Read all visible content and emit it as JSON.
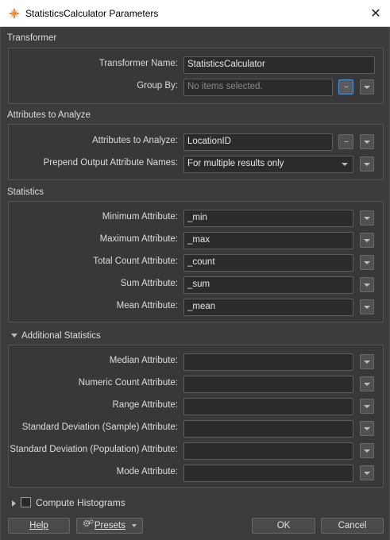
{
  "window": {
    "title": "StatisticsCalculator Parameters",
    "close_glyph": "✕"
  },
  "sections": {
    "transformer": "Transformer",
    "attributes": "Attributes to Analyze",
    "statistics": "Statistics",
    "additional": "Additional Statistics",
    "histograms": "Compute Histograms"
  },
  "transformer": {
    "name_label": "Transformer Name:",
    "name_value": "StatisticsCalculator",
    "group_by_label": "Group By:",
    "group_by_placeholder": "No items selected.",
    "dots": "..."
  },
  "attributes": {
    "analyze_label": "Attributes to Analyze:",
    "analyze_value": "LocationID",
    "prepend_label": "Prepend Output Attribute Names:",
    "prepend_value": "For multiple results only"
  },
  "statistics": [
    {
      "label": "Minimum Attribute:",
      "value": "_min"
    },
    {
      "label": "Maximum Attribute:",
      "value": "_max"
    },
    {
      "label": "Total Count Attribute:",
      "value": "_count"
    },
    {
      "label": "Sum Attribute:",
      "value": "_sum"
    },
    {
      "label": "Mean Attribute:",
      "value": "_mean"
    }
  ],
  "additional": [
    {
      "label": "Median Attribute:",
      "value": ""
    },
    {
      "label": "Numeric Count Attribute:",
      "value": ""
    },
    {
      "label": "Range Attribute:",
      "value": ""
    },
    {
      "label": "Standard Deviation (Sample) Attribute:",
      "value": ""
    },
    {
      "label": "Standard Deviation (Population) Attribute:",
      "value": ""
    },
    {
      "label": "Mode Attribute:",
      "value": ""
    }
  ],
  "footer": {
    "help": "Help",
    "presets": "Presets",
    "ok": "OK",
    "cancel": "Cancel"
  }
}
